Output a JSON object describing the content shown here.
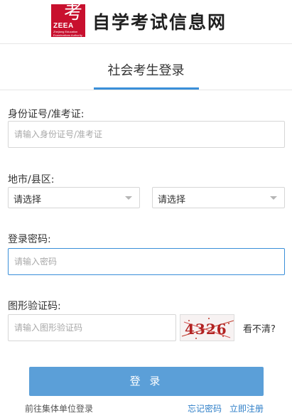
{
  "header": {
    "logo_big": "考",
    "logo_small": "ZEEA",
    "logo_tiny": "Zhejiang Education Examinations Authority",
    "site_title": "自学考试信息网"
  },
  "tab": {
    "title": "社会考生登录"
  },
  "form": {
    "id_label": "身份证号/准考证:",
    "id_placeholder": "请输入身份证号/准考证",
    "region_label": "地市/县区:",
    "city_select": "请选择",
    "county_select": "请选择",
    "password_label": "登录密码:",
    "password_placeholder": "请输入密码",
    "captcha_label": "图形验证码:",
    "captcha_placeholder": "请输入图形验证码",
    "captcha_text": "4326",
    "cant_see": "看不清?"
  },
  "actions": {
    "login": "登 录",
    "group_login": "前往集体单位登录",
    "forgot": "忘记密码",
    "register": "立即注册"
  },
  "colors": {
    "accent": "#3a8fd9",
    "button": "#5b9fd8",
    "logo_red": "#c8102e"
  }
}
